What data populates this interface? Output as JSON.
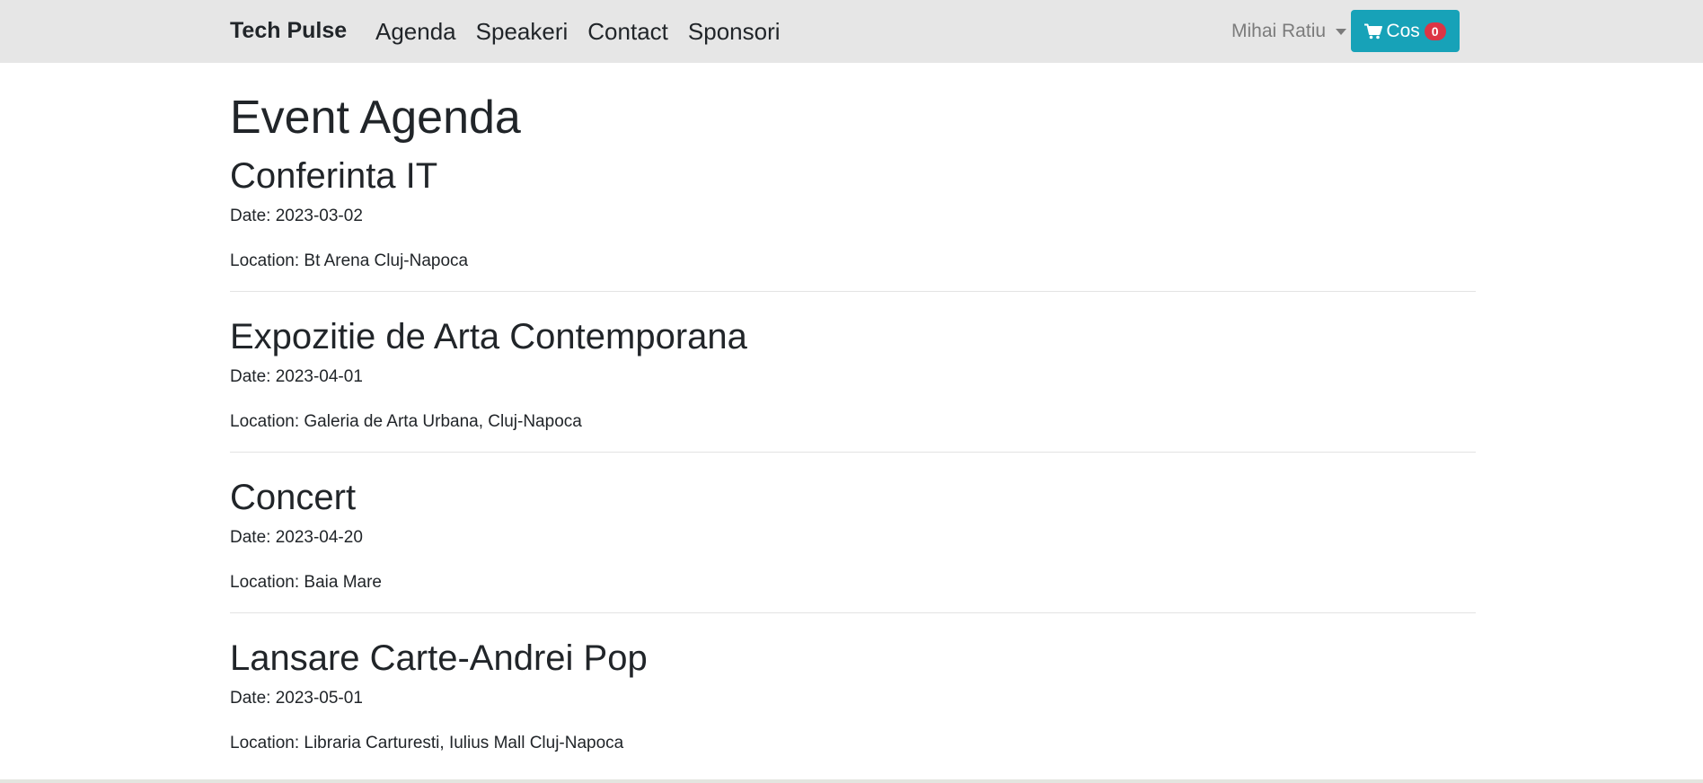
{
  "navbar": {
    "brand": "Tech Pulse",
    "links": [
      {
        "label": "Agenda"
      },
      {
        "label": "Speakeri"
      },
      {
        "label": "Contact"
      },
      {
        "label": "Sponsori"
      }
    ],
    "user_name": "Mihai Ratiu",
    "cart_label": "Cos",
    "cart_count": "0",
    "cart_icon": "shopping-cart-icon",
    "accent_color": "#17a2b8",
    "badge_color": "#dc3545"
  },
  "main": {
    "title": "Event Agenda",
    "events": [
      {
        "title": "Conferinta IT",
        "date": "Date: 2023-03-02",
        "location": "Location: Bt Arena Cluj-Napoca"
      },
      {
        "title": "Expozitie de Arta Contemporana",
        "date": "Date: 2023-04-01",
        "location": "Location: Galeria de Arta Urbana, Cluj-Napoca"
      },
      {
        "title": "Concert",
        "date": "Date: 2023-04-20",
        "location": "Location: Baia Mare"
      },
      {
        "title": "Lansare Carte-Andrei Pop",
        "date": "Date: 2023-05-01",
        "location": "Location: Libraria Carturesti, Iulius Mall Cluj-Napoca"
      }
    ]
  }
}
